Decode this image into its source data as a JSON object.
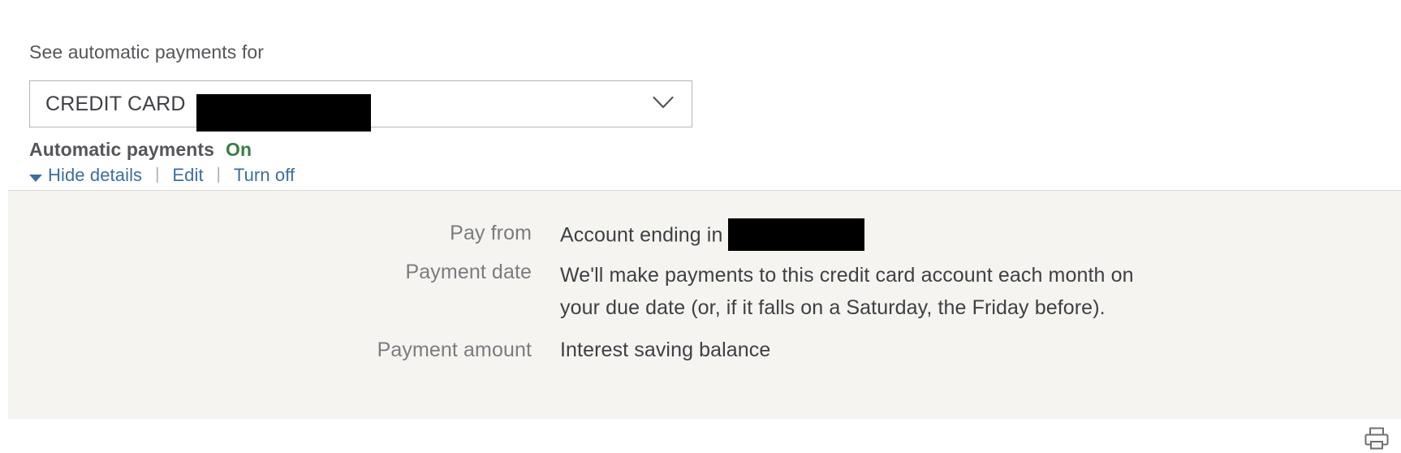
{
  "selector": {
    "label": "See automatic payments for",
    "selected_value": "CREDIT CARD",
    "redacted_suffix": "",
    "chevron_icon": "chevron-down-icon"
  },
  "status": {
    "title": "Automatic payments",
    "value": "On",
    "value_color": "#3a7d44"
  },
  "actions": {
    "hide_details": "Hide details",
    "edit": "Edit",
    "turn_off": "Turn off",
    "separator": "|",
    "caret_icon": "caret-down-icon",
    "link_color": "#3a6ea5"
  },
  "details": {
    "rows": [
      {
        "label": "Pay from",
        "value": "Account ending in",
        "has_redaction": true
      },
      {
        "label": "Payment date",
        "value": "We'll make payments to this credit card account each month on your due date (or, if it falls on a Saturday, the Friday before).",
        "has_redaction": false
      },
      {
        "label": "Payment amount",
        "value": "Interest saving balance",
        "has_redaction": false
      }
    ],
    "print_icon": "printer-icon",
    "background_color": "#f5f4f1"
  }
}
